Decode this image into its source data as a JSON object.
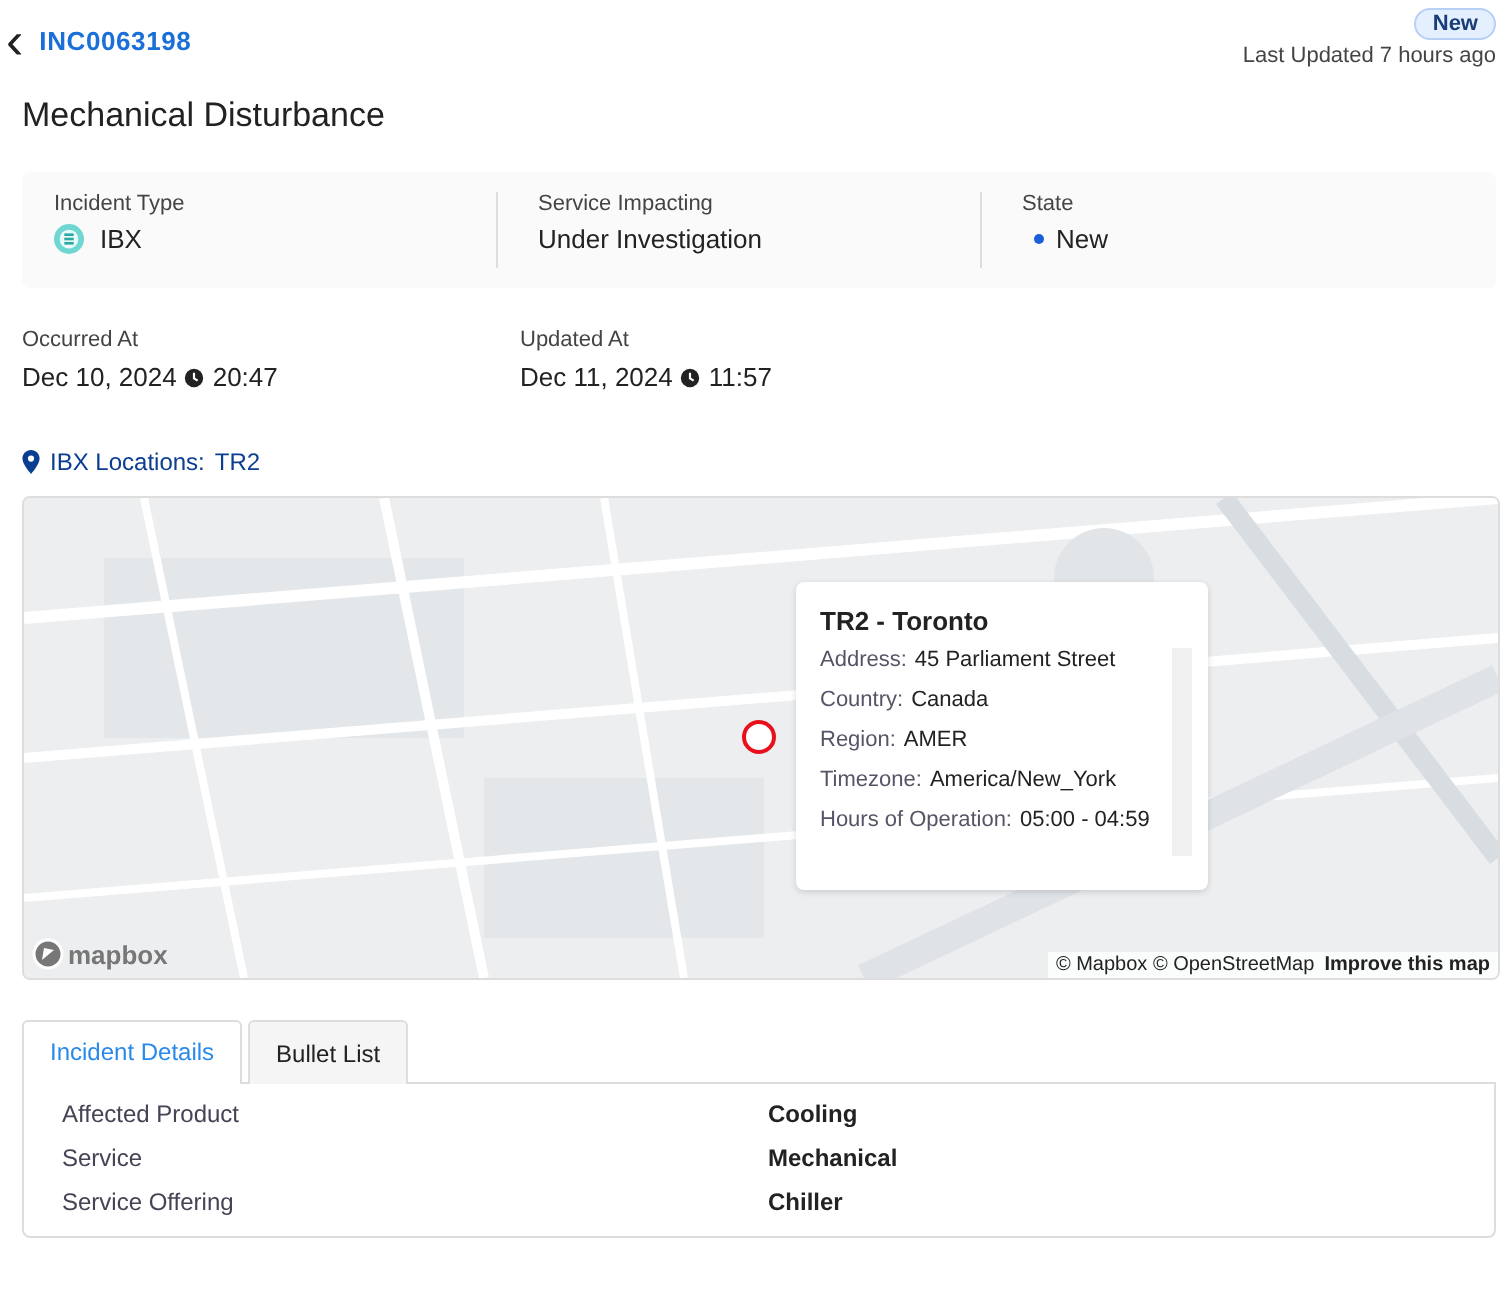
{
  "header": {
    "back_icon": "‹",
    "incident_id": "INC0063198",
    "status_badge": "New",
    "last_updated": "Last Updated 7 hours ago"
  },
  "title": "Mechanical Disturbance",
  "summary": [
    {
      "kind": "type",
      "label": "Incident Type",
      "value": "IBX"
    },
    {
      "kind": "plain",
      "label": "Service Impacting",
      "value": "Under Investigation"
    },
    {
      "kind": "state",
      "label": "State",
      "value": "New",
      "color": "#1a5ed8"
    }
  ],
  "dates": [
    {
      "label": "Occurred At",
      "date": "Dec 10, 2024",
      "time": "20:47"
    },
    {
      "label": "Updated At",
      "date": "Dec 11, 2024",
      "time": "11:57"
    }
  ],
  "locations": {
    "label": "IBX Locations:",
    "value": "TR2"
  },
  "map": {
    "logo": "mapbox",
    "attribution": "© Mapbox © OpenStreetMap",
    "improve_link": "Improve this map",
    "popup": {
      "title": "TR2 - Toronto",
      "rows": [
        {
          "label": "Address:",
          "value": "45 Parliament Street"
        },
        {
          "label": "Country:",
          "value": "Canada"
        },
        {
          "label": "Region:",
          "value": "AMER"
        },
        {
          "label": "Timezone:",
          "value": "America/New_York"
        },
        {
          "label": "Hours of Operation:",
          "value": "05:00 - 04:59"
        }
      ]
    }
  },
  "tabs": [
    {
      "label": "Incident Details",
      "selected": true
    },
    {
      "label": "Bullet List",
      "selected": false
    }
  ],
  "details": [
    {
      "label": "Affected Product",
      "value": "Cooling"
    },
    {
      "label": "Service",
      "value": "Mechanical"
    },
    {
      "label": "Service Offering",
      "value": "Chiller"
    }
  ]
}
